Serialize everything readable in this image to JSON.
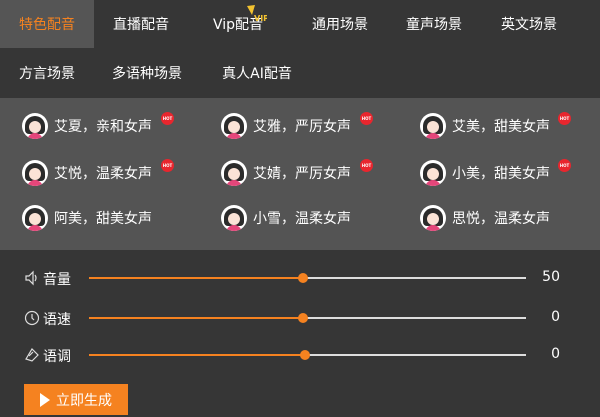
{
  "tabs_row1": [
    {
      "label": "特色配音",
      "active": true
    },
    {
      "label": "直播配音"
    },
    {
      "label": "Vip配音"
    },
    {
      "label": "通用场景"
    },
    {
      "label": "童声场景"
    },
    {
      "label": "英文场景"
    }
  ],
  "tabs_row2": [
    {
      "label": "方言场景"
    },
    {
      "label": "多语种场景"
    },
    {
      "label": "真人AI配音"
    }
  ],
  "vip_badge": "VIP",
  "hot_badge": "HOT",
  "voices": [
    {
      "label": "艾夏，亲和女声",
      "hot": true
    },
    {
      "label": "艾雅，严厉女声",
      "hot": true
    },
    {
      "label": "艾美，甜美女声",
      "hot": true
    },
    {
      "label": "艾悦，温柔女声",
      "hot": true
    },
    {
      "label": "艾婧，严厉女声",
      "hot": true
    },
    {
      "label": "小美，甜美女声",
      "hot": true
    },
    {
      "label": "阿美，甜美女声",
      "hot": false
    },
    {
      "label": "小雪，温柔女声",
      "hot": false
    },
    {
      "label": "思悦，温柔女声",
      "hot": false
    }
  ],
  "sliders": [
    {
      "label": "音量",
      "value": "50",
      "level": 0.49,
      "icon": "volume-icon"
    },
    {
      "label": "语速",
      "value": "0",
      "level": 0.49,
      "icon": "speed-icon"
    },
    {
      "label": "语调",
      "value": "0",
      "level": 0.495,
      "icon": "pitch-icon"
    }
  ],
  "generate_label": "立即生成",
  "colors": {
    "accent": "#f58220",
    "hot": "#e8262e",
    "panel": "#545454",
    "background": "#363636"
  }
}
